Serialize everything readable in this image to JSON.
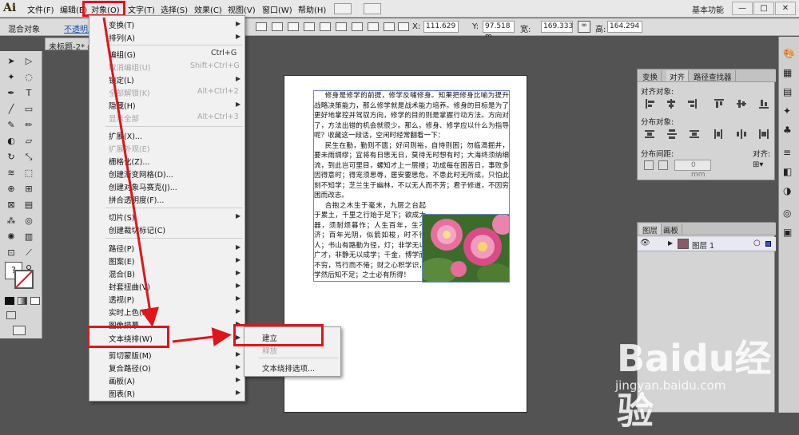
{
  "app": {
    "logo": "Ai"
  },
  "menubar": {
    "items": [
      "文件(F)",
      "编辑(E)",
      "对象(O)",
      "文字(T)",
      "选择(S)",
      "效果(C)",
      "视图(V)",
      "窗口(W)",
      "帮助(H)"
    ],
    "workspace": "基本功能",
    "window_buttons": [
      "—",
      "□",
      "✕"
    ]
  },
  "controlbar": {
    "mode_label": "混合对象",
    "opacity_label": "不透明度",
    "x_label": "X:",
    "x_value": "111.629",
    "y_label": "Y:",
    "y_value": "97.518 m",
    "w_label": "宽:",
    "w_value": "169.333",
    "h_label": "高:",
    "h_value": "164.294"
  },
  "document": {
    "tab_title": "未标题-2* @"
  },
  "object_menu": {
    "items": [
      {
        "label": "变换(T)",
        "shortcut": "",
        "submenu": true,
        "disabled": false
      },
      {
        "label": "排列(A)",
        "shortcut": "",
        "submenu": true,
        "disabled": false
      },
      {
        "label": "编组(G)",
        "shortcut": "Ctrl+G",
        "submenu": false,
        "disabled": false
      },
      {
        "label": "取消编组(U)",
        "shortcut": "Shift+Ctrl+G",
        "submenu": false,
        "disabled": true
      },
      {
        "label": "锁定(L)",
        "shortcut": "",
        "submenu": true,
        "disabled": false
      },
      {
        "label": "全部解锁(K)",
        "shortcut": "Alt+Ctrl+2",
        "submenu": false,
        "disabled": true
      },
      {
        "label": "隐藏(H)",
        "shortcut": "",
        "submenu": true,
        "disabled": false
      },
      {
        "label": "显示全部",
        "shortcut": "Alt+Ctrl+3",
        "submenu": false,
        "disabled": true
      },
      {
        "label": "扩展(X)...",
        "shortcut": "",
        "submenu": false,
        "disabled": false
      },
      {
        "label": "扩展外观(E)",
        "shortcut": "",
        "submenu": false,
        "disabled": true
      },
      {
        "label": "栅格化(Z)...",
        "shortcut": "",
        "submenu": false,
        "disabled": false
      },
      {
        "label": "创建渐变网格(D)...",
        "shortcut": "",
        "submenu": false,
        "disabled": false
      },
      {
        "label": "创建对象马赛克(J)...",
        "shortcut": "",
        "submenu": false,
        "disabled": false
      },
      {
        "label": "拼合透明度(F)...",
        "shortcut": "",
        "submenu": false,
        "disabled": false
      },
      {
        "label": "切片(S)",
        "shortcut": "",
        "submenu": true,
        "disabled": false
      },
      {
        "label": "创建裁切标记(C)",
        "shortcut": "",
        "submenu": false,
        "disabled": false
      },
      {
        "label": "路径(P)",
        "shortcut": "",
        "submenu": true,
        "disabled": false
      },
      {
        "label": "图案(E)",
        "shortcut": "",
        "submenu": true,
        "disabled": false
      },
      {
        "label": "混合(B)",
        "shortcut": "",
        "submenu": true,
        "disabled": false
      },
      {
        "label": "封套扭曲(V)",
        "shortcut": "",
        "submenu": true,
        "disabled": false
      },
      {
        "label": "透视(P)",
        "shortcut": "",
        "submenu": true,
        "disabled": false
      },
      {
        "label": "实时上色(N)",
        "shortcut": "",
        "submenu": true,
        "disabled": false
      },
      {
        "label": "图像描摹",
        "shortcut": "",
        "submenu": true,
        "disabled": false
      },
      {
        "label": "文本绕排(W)",
        "shortcut": "",
        "submenu": true,
        "disabled": false
      },
      {
        "label": "剪切蒙版(M)",
        "shortcut": "",
        "submenu": true,
        "disabled": false
      },
      {
        "label": "复合路径(O)",
        "shortcut": "",
        "submenu": true,
        "disabled": false
      },
      {
        "label": "画板(A)",
        "shortcut": "",
        "submenu": true,
        "disabled": false
      },
      {
        "label": "图表(R)",
        "shortcut": "",
        "submenu": true,
        "disabled": false
      }
    ]
  },
  "text_wrap_submenu": {
    "items": [
      {
        "label": "建立",
        "disabled": false
      },
      {
        "label": "释放",
        "disabled": true
      },
      {
        "label": "文本绕排选项...",
        "disabled": false
      }
    ]
  },
  "artboard_text": [
    "修身是修学的前提，修学反哺修身。知果把修身比喻为提升战略决策能力，那么修学就是战术能力培养。修身的目标是为了更好地掌控并驾驭方向，修学的目的则是掌握行动方法。方向对了，方法出错的机会就很少。那么，修身、修学应以什么为指导呢？收藏这一段话，空闲时经常翻看一下：",
    "民生在勤，勤则不匮；好问则裕，自恃则困；勿临渴掘井，要未雨绸缪；宜将有日思无日，莫待无时想有时；大海终须纳细流，到此岂可里目，螺知才上一层楼；功成每在困苦日，事败多因得意时；得宠须思辱，居安要思危。不患此时无所成，只怕此刻不知学；芝兰生于幽林，不以无人而不芳；君子修道，不因穷困而改志。",
    "合抱之木生于毫末，九层之台起于累土，千里之行始于足下；欲成大器，须耐烦暮作；人生百年，生不济；百年光阴，似箭如梭，时不待人；书山有路勤为径，灯；非学无以广才，非静无以成学；千金，博学而不穷，笃行而不倦；财之心积学识，学然后知不足；之士必有所得！"
  ],
  "align_panel": {
    "tabs": [
      "变换",
      "对齐",
      "路径查找器"
    ],
    "align_objects_label": "对齐对象:",
    "distribute_objects_label": "分布对象:",
    "distribute_spacing_label": "分布间距:",
    "align_to_label": "对齐:",
    "spacing_value": "0 mm"
  },
  "layers_panel": {
    "tabs": [
      "图层",
      "画板"
    ],
    "layers": [
      {
        "name": "图层 1"
      }
    ]
  },
  "watermark": {
    "logo": "Baidu经验",
    "url": "jingyan.baidu.com"
  },
  "colors": {
    "highlight_red": "#e0141b",
    "menu_bg": "#f1f1f1",
    "canvas_bg": "#535353"
  }
}
